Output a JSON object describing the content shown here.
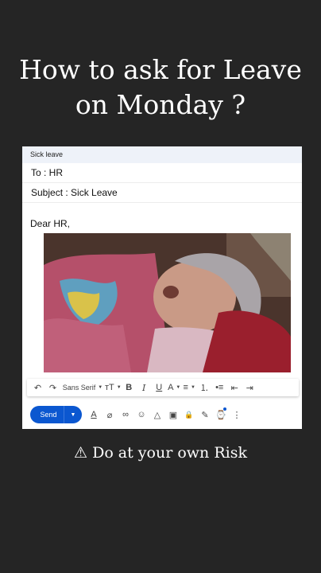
{
  "headline": {
    "line1": "How to ask for Leave",
    "line2": "on Monday ?"
  },
  "compose": {
    "window_title": "Sick leave",
    "to": "To : HR",
    "subject": "Subject : Sick Leave",
    "greeting": "Dear HR,"
  },
  "format_toolbar": {
    "undo": "↶",
    "redo": "↷",
    "font": "Sans Serif",
    "size": "тT",
    "bold": "B",
    "italic": "I",
    "underline": "U",
    "text_color": "A",
    "align": "≡",
    "numbered_list": "⒈",
    "bulleted_list": "•≡",
    "indent_less": "⇤",
    "indent_more": "⇥",
    "caret": "▼"
  },
  "action_bar": {
    "send_label": "Send",
    "send_more": "▼",
    "format": "A",
    "attach": "⌀",
    "link": "∞",
    "emoji": "☺",
    "drive": "△",
    "photo": "▣",
    "confidential": "🔒",
    "signature": "✎",
    "schedule": "⌚",
    "more": "⋮"
  },
  "warning": "⚠ Do at your own Risk",
  "colors": {
    "background": "#252525",
    "send_blue": "#0b57d0",
    "compose_bar": "#eef2f9"
  }
}
